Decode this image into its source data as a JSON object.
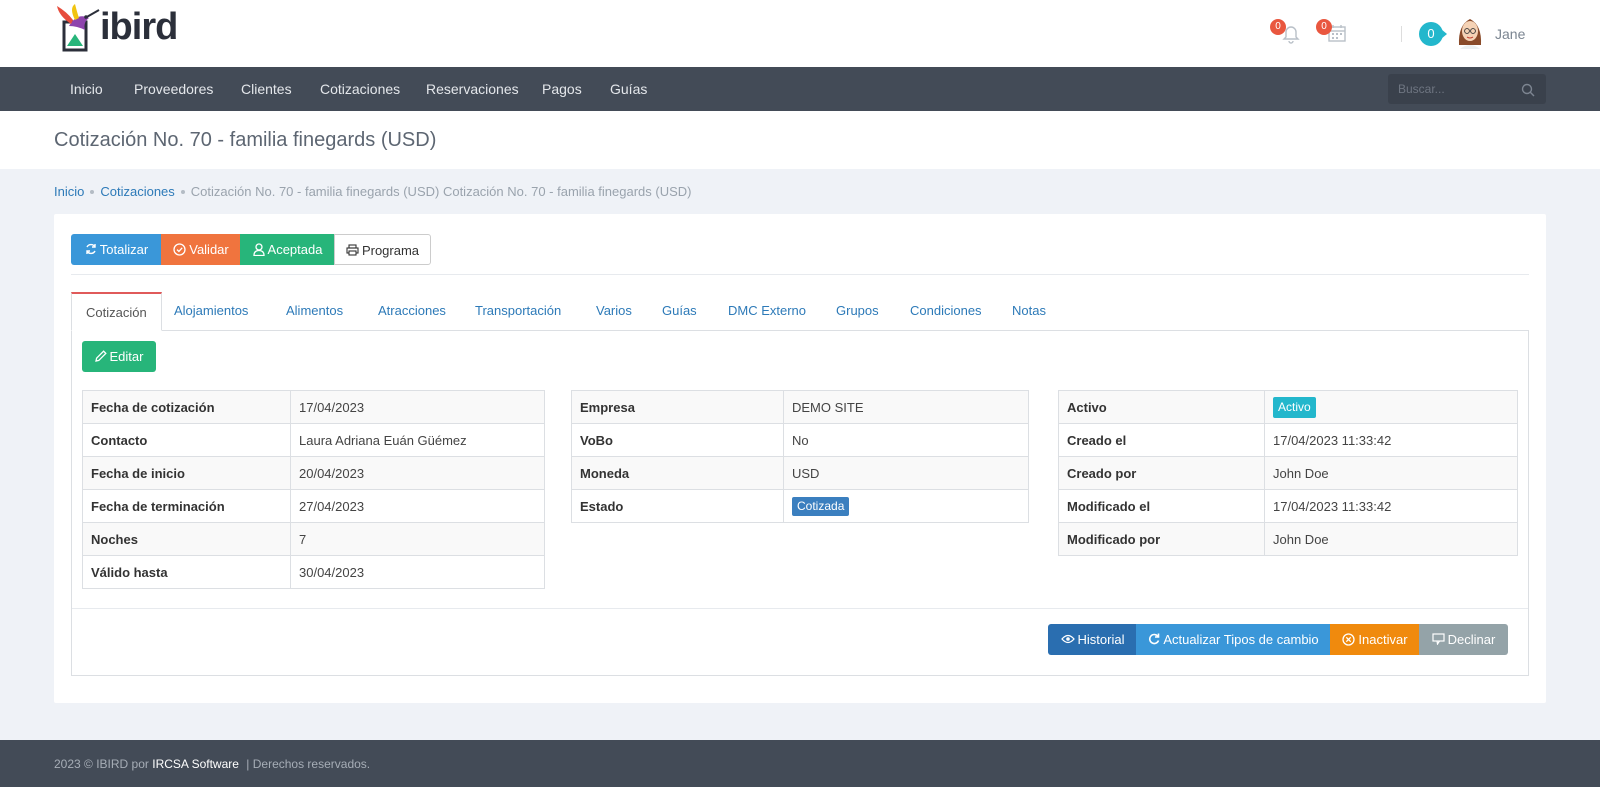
{
  "app": {
    "logo_text": "ibird"
  },
  "header": {
    "notifications_count": "0",
    "calendar_count": "0",
    "messages_count": "0",
    "user_name": "Jane"
  },
  "nav": {
    "items": [
      "Inicio",
      "Proveedores",
      "Clientes",
      "Cotizaciones",
      "Reservaciones",
      "Pagos",
      "Guías"
    ],
    "search_placeholder": "Buscar..."
  },
  "page": {
    "title": "Cotización No. 70 - familia finegards (USD)"
  },
  "breadcrumb": {
    "home": "Inicio",
    "section": "Cotizaciones",
    "current": "Cotización No. 70 - familia finegards (USD) Cotización No. 70 - familia finegards (USD)"
  },
  "toolbar": {
    "totalizar": "Totalizar",
    "validar": "Validar",
    "aceptada": "Aceptada",
    "programa": "Programa"
  },
  "tabs": [
    "Cotización",
    "Alojamientos",
    "Alimentos",
    "Atracciones",
    "Transportación",
    "Varios",
    "Guías",
    "DMC Externo",
    "Grupos",
    "Condiciones",
    "Notas"
  ],
  "edit_label": "Editar",
  "table1": {
    "rows": [
      {
        "k": "Fecha de cotización",
        "v": "17/04/2023"
      },
      {
        "k": "Contacto",
        "v": "Laura Adriana Euán Güémez"
      },
      {
        "k": "Fecha de inicio",
        "v": "20/04/2023"
      },
      {
        "k": "Fecha de terminación",
        "v": "27/04/2023"
      },
      {
        "k": "Noches",
        "v": "7"
      },
      {
        "k": "Válido hasta",
        "v": "30/04/2023"
      }
    ]
  },
  "table2": {
    "rows": [
      {
        "k": "Empresa",
        "v": "DEMO SITE"
      },
      {
        "k": "VoBo",
        "v": "No"
      },
      {
        "k": "Moneda",
        "v": "USD"
      },
      {
        "k": "Estado",
        "v": "Cotizada"
      }
    ]
  },
  "table3": {
    "rows": [
      {
        "k": "Activo",
        "v": "Activo"
      },
      {
        "k": "Creado el",
        "v": "17/04/2023 11:33:42"
      },
      {
        "k": "Creado por",
        "v": "John Doe"
      },
      {
        "k": "Modificado el",
        "v": "17/04/2023 11:33:42"
      },
      {
        "k": "Modificado por",
        "v": "John Doe"
      }
    ]
  },
  "actions": {
    "historial": "Historial",
    "actualizar": "Actualizar Tipos de cambio",
    "inactivar": "Inactivar",
    "declinar": "Declinar"
  },
  "footer": {
    "prefix": "2023 © IBIRD por",
    "brand": "IRCSA Software",
    "suffix": "|  Derechos reservados."
  },
  "colors": {
    "nav_bg": "#434b57",
    "primary": "#3a97d9",
    "success": "#27b57a",
    "warning": "#f0743e",
    "orange": "#f08a0d",
    "info": "#23b7cc",
    "danger_badge": "#e9573f"
  }
}
